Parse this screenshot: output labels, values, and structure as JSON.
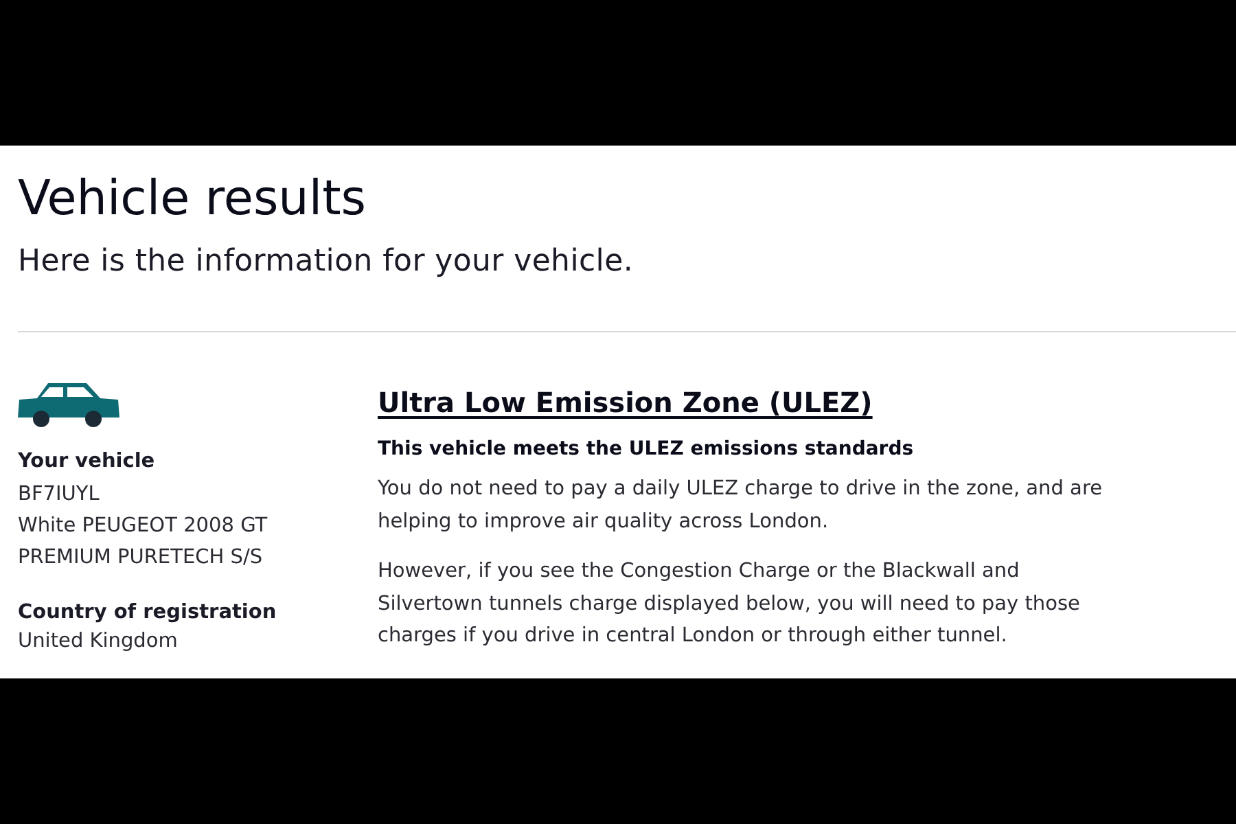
{
  "page": {
    "title": "Vehicle results",
    "intro": "Here is the information for your vehicle."
  },
  "vehicle": {
    "heading": "Your vehicle",
    "registration": "BF7IUYL",
    "description": "White PEUGEOT 2008 GT PREMIUM PURETECH S/S",
    "country_label": "Country of registration",
    "country": "United Kingdom"
  },
  "ulez": {
    "heading": "Ultra Low Emission Zone (ULEZ)",
    "status": "This vehicle meets the ULEZ emissions standards",
    "paragraphs": [
      "You do not need to pay a daily ULEZ charge to drive in the zone, and are helping to improve air quality across London.",
      "However, if you see the Congestion Charge or the Blackwall and Silvertown tunnels charge displayed below, you will need to pay those charges if you drive in central London or through either tunnel."
    ]
  }
}
